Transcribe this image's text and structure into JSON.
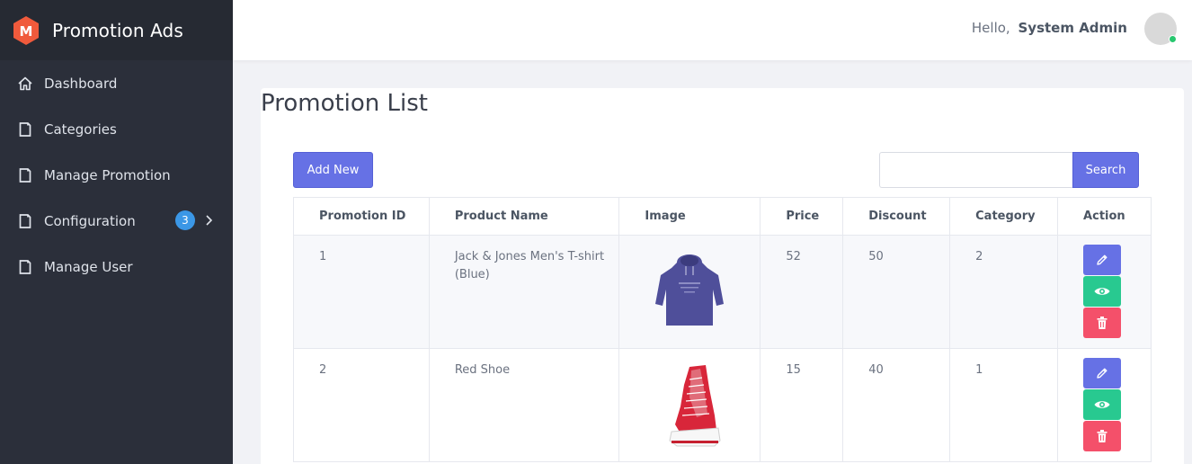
{
  "app": {
    "name": "Promotion Ads",
    "logo_letter": "M",
    "accent": "#6671e5",
    "logo_color": "#f05a3c"
  },
  "sidebar": {
    "items": [
      {
        "label": "Dashboard",
        "icon": "home-icon"
      },
      {
        "label": "Categories",
        "icon": "page-icon"
      },
      {
        "label": "Manage Promotion",
        "icon": "page-icon"
      },
      {
        "label": "Configuration",
        "icon": "page-icon",
        "badge": "3",
        "has_submenu": true
      },
      {
        "label": "Manage User",
        "icon": "page-icon"
      }
    ]
  },
  "header": {
    "greeting": "Hello,",
    "user_name": "System Admin"
  },
  "main": {
    "title": "Promotion List",
    "add_button": "Add New",
    "search": {
      "value": "",
      "placeholder": "",
      "button": "Search"
    },
    "table": {
      "columns": [
        "Promotion ID",
        "Product Name",
        "Image",
        "Price",
        "Discount",
        "Category",
        "Action"
      ],
      "rows": [
        {
          "id": "1",
          "name": "Jack & Jones Men's T-shirt (Blue)",
          "image": "blue-hoodie-image",
          "price": "52",
          "discount": "50",
          "category": "2"
        },
        {
          "id": "2",
          "name": "Red Shoe",
          "image": "red-sneaker-image",
          "price": "15",
          "discount": "40",
          "category": "1"
        }
      ],
      "action_icons": [
        "pencil-icon",
        "eye-icon",
        "trash-icon"
      ]
    }
  },
  "colors": {
    "edit": "#6671e5",
    "view": "#28c990",
    "delete": "#f4506a",
    "badge": "#3b97e6"
  }
}
